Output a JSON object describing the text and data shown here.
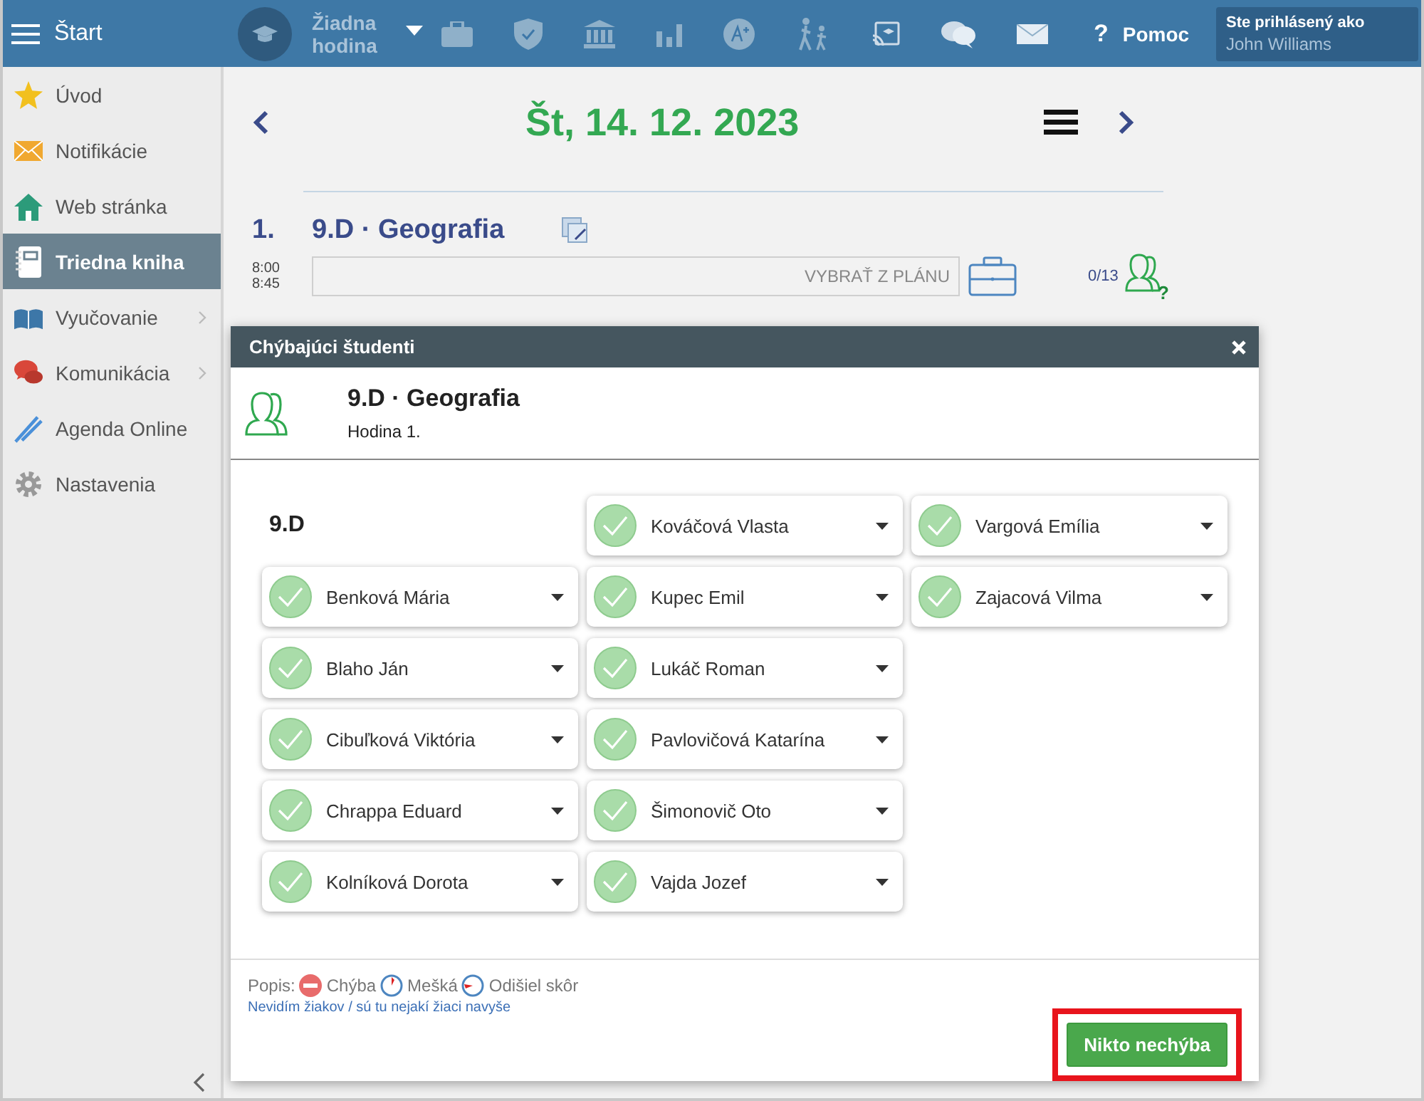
{
  "topbar": {
    "menu_label": "Štart",
    "lesson_selector": "Žiadna hodina",
    "help_icon": "?",
    "help": "Pomoc",
    "user_caption": "Ste prihlásený ako",
    "user_name": "John Williams"
  },
  "sidebar": {
    "items": [
      {
        "label": "Úvod",
        "selected": false,
        "submenu": false
      },
      {
        "label": "Notifikácie",
        "selected": false,
        "submenu": false
      },
      {
        "label": "Web stránka",
        "selected": false,
        "submenu": false
      },
      {
        "label": "Triedna kniha",
        "selected": true,
        "submenu": false
      },
      {
        "label": "Vyučovanie",
        "selected": false,
        "submenu": true
      },
      {
        "label": "Komunikácia",
        "selected": false,
        "submenu": true
      },
      {
        "label": "Agenda Online",
        "selected": false,
        "submenu": false
      },
      {
        "label": "Nastavenia",
        "selected": false,
        "submenu": false
      }
    ]
  },
  "day": {
    "date": "Št, 14. 12. 2023"
  },
  "lesson": {
    "number": "1.",
    "title": "9.D · Geografia",
    "start": "8:00",
    "end": "8:45",
    "plan_placeholder": "VYBRAŤ Z PLÁNU",
    "attendance": "0/13",
    "attendance_mark": "?"
  },
  "dialog": {
    "title": "Chýbajúci študenti",
    "class_subject": "9.D · Geografia",
    "period": "Hodina 1.",
    "class_heading": "9.D",
    "students": [
      {
        "name": "Benková Mária",
        "present": true
      },
      {
        "name": "Blaho Ján",
        "present": true
      },
      {
        "name": "Cibuľková Viktória",
        "present": true
      },
      {
        "name": "Chrappa Eduard",
        "present": true
      },
      {
        "name": "Kolníková Dorota",
        "present": true
      },
      {
        "name": "Kováčová Vlasta",
        "present": true
      },
      {
        "name": "Kupec Emil",
        "present": true
      },
      {
        "name": "Lukáč Roman",
        "present": true
      },
      {
        "name": "Pavlovičová Katarína",
        "present": true
      },
      {
        "name": "Šimonovič Oto",
        "present": true
      },
      {
        "name": "Vajda Jozef",
        "present": true
      },
      {
        "name": "Vargová Emília",
        "present": true
      },
      {
        "name": "Zajacová Vilma",
        "present": true
      }
    ],
    "legend_label": "Popis:",
    "legend": [
      {
        "kind": "absent",
        "label": "Chýba"
      },
      {
        "kind": "late",
        "label": "Mešká"
      },
      {
        "kind": "left",
        "label": "Odišiel skôr"
      }
    ],
    "link": "Nevidím žiakov / sú tu nejakí žiaci navyše",
    "confirm_button": {
      "label": "Nikto nechýba",
      "highlighted": true
    }
  }
}
